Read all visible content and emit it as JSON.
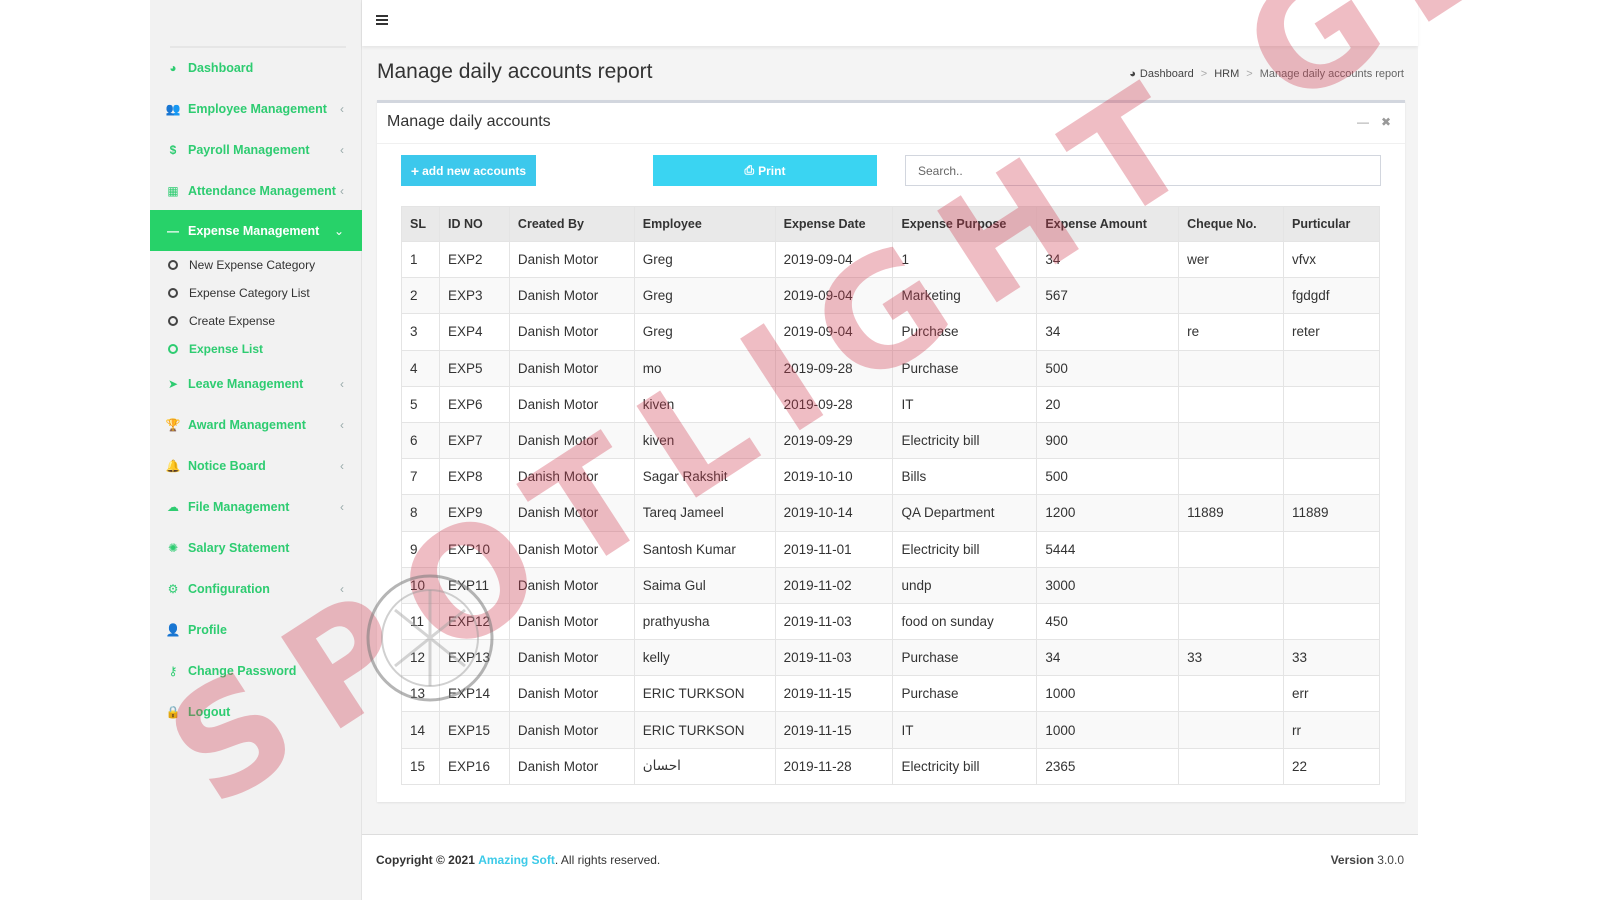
{
  "sidebar": {
    "items": [
      {
        "label": "Dashboard",
        "icon": "dashboard-icon",
        "glyph": "◕",
        "chevron": ""
      },
      {
        "label": "Employee Management",
        "icon": "users-icon",
        "glyph": "👥",
        "chevron": "‹"
      },
      {
        "label": "Payroll Management",
        "icon": "dollar-icon",
        "glyph": "$",
        "chevron": "‹"
      },
      {
        "label": "Attendance Management",
        "icon": "calendar-icon",
        "glyph": "▦",
        "chevron": "‹"
      },
      {
        "label": "Expense Management",
        "icon": "minus-icon",
        "glyph": "—",
        "chevron": "⌄"
      },
      {
        "label": "Leave Management",
        "icon": "paper-plane-icon",
        "glyph": "➤",
        "chevron": "‹"
      },
      {
        "label": "Award Management",
        "icon": "trophy-icon",
        "glyph": "🏆",
        "chevron": "‹"
      },
      {
        "label": "Notice Board",
        "icon": "bell-icon",
        "glyph": "🔔",
        "chevron": "‹"
      },
      {
        "label": "File Management",
        "icon": "cloud-upload-icon",
        "glyph": "☁",
        "chevron": "‹"
      },
      {
        "label": "Salary Statement",
        "icon": "certificate-icon",
        "glyph": "✺",
        "chevron": ""
      },
      {
        "label": "Configuration",
        "icon": "gear-icon",
        "glyph": "⚙",
        "chevron": "‹"
      },
      {
        "label": "Profile",
        "icon": "user-icon",
        "glyph": "👤",
        "chevron": ""
      },
      {
        "label": "Change Password",
        "icon": "key-icon",
        "glyph": "⚷",
        "chevron": ""
      },
      {
        "label": "Logout",
        "icon": "lock-icon",
        "glyph": "🔒",
        "chevron": ""
      }
    ],
    "subitems": [
      {
        "label": "New Expense Category"
      },
      {
        "label": "Expense Category List"
      },
      {
        "label": "Create Expense"
      },
      {
        "label": "Expense List"
      }
    ]
  },
  "header": {
    "title": "Manage daily accounts report",
    "breadcrumb": [
      "Dashboard",
      "HRM",
      "Manage daily accounts report"
    ]
  },
  "box": {
    "title": "Manage daily accounts",
    "add_label": "add new accounts",
    "print_label": "Print",
    "search_placeholder": "Search.."
  },
  "table": {
    "columns": [
      "SL",
      "ID NO",
      "Created By",
      "Employee",
      "Expense Date",
      "Expense Purpose",
      "Expense Amount",
      "Cheque No.",
      "Purticular"
    ],
    "rows": [
      [
        "1",
        "EXP2",
        "Danish Motor",
        "Greg",
        "2019-09-04",
        "1",
        "34",
        "wer",
        "vfvx"
      ],
      [
        "2",
        "EXP3",
        "Danish Motor",
        "Greg",
        "2019-09-04",
        "Marketing",
        "567",
        "",
        "fgdgdf"
      ],
      [
        "3",
        "EXP4",
        "Danish Motor",
        "Greg",
        "2019-09-04",
        "Purchase",
        "34",
        "re",
        "reter"
      ],
      [
        "4",
        "EXP5",
        "Danish Motor",
        "mo",
        "2019-09-28",
        "Purchase",
        "500",
        "",
        ""
      ],
      [
        "5",
        "EXP6",
        "Danish Motor",
        "kiven",
        "2019-09-28",
        "IT",
        "20",
        "",
        ""
      ],
      [
        "6",
        "EXP7",
        "Danish Motor",
        "kiven",
        "2019-09-29",
        "Electricity bill",
        "900",
        "",
        ""
      ],
      [
        "7",
        "EXP8",
        "Danish Motor",
        "Sagar Rakshit",
        "2019-10-10",
        "Bills",
        "500",
        "",
        ""
      ],
      [
        "8",
        "EXP9",
        "Danish Motor",
        "Tareq Jameel",
        "2019-10-14",
        "QA Department",
        "1200",
        "11889",
        "11889"
      ],
      [
        "9",
        "EXP10",
        "Danish Motor",
        "Santosh Kumar",
        "2019-11-01",
        "Electricity bill",
        "5444",
        "",
        ""
      ],
      [
        "10",
        "EXP11",
        "Danish Motor",
        "Saima Gul",
        "2019-11-02",
        "undp",
        "3000",
        "",
        ""
      ],
      [
        "11",
        "EXP12",
        "Danish Motor",
        "prathyusha",
        "2019-11-03",
        "food on sunday",
        "450",
        "",
        ""
      ],
      [
        "12",
        "EXP13",
        "Danish Motor",
        "kelly",
        "2019-11-03",
        "Purchase",
        "34",
        "33",
        "33"
      ],
      [
        "13",
        "EXP14",
        "Danish Motor",
        "ERIC TURKSON",
        "2019-11-15",
        "Purchase",
        "1000",
        "",
        "err"
      ],
      [
        "14",
        "EXP15",
        "Danish Motor",
        "ERIC TURKSON",
        "2019-11-15",
        "IT",
        "1000",
        "",
        "rr"
      ],
      [
        "15",
        "EXP16",
        "Danish Motor",
        "احسان",
        "2019-11-28",
        "Electricity bill",
        "2365",
        "",
        "22"
      ]
    ]
  },
  "footer": {
    "copyright_prefix": "Copyright © 2021",
    "brand": "Amazing Soft",
    "suffix": ". All rights reserved.",
    "version_label": "Version",
    "version": "3.0.0"
  },
  "watermark": {
    "text": "SPOTLIGHT GB"
  },
  "colors": {
    "accent_green": "#2ecc71",
    "active_bg": "#27d269",
    "button_cyan": "#3cc8ec",
    "brand_link": "#3ccae8"
  }
}
